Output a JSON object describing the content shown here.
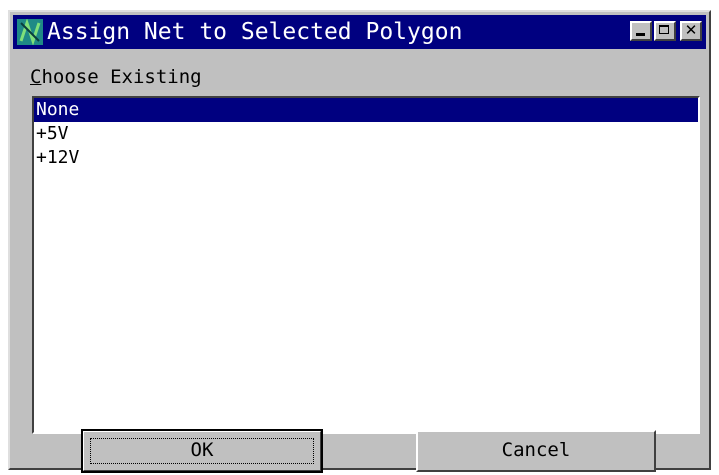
{
  "window": {
    "title": "Assign Net to Selected Polygon",
    "controls": [
      "minimize",
      "maximize",
      "close"
    ]
  },
  "section": {
    "label_first": "C",
    "label_rest": "hoose Existing"
  },
  "nets": {
    "items": [
      "None",
      "+5V",
      "+12V"
    ],
    "selected": "None"
  },
  "buttons": {
    "ok": "OK",
    "cancel": "Cancel"
  },
  "colors": {
    "title_bar": "#000080",
    "face": "#c0c0c0",
    "selection": "#000080",
    "icon": "#1f8a86"
  },
  "icons": {
    "app": "net-assign-icon",
    "close": "close-icon",
    "minimize": "minimize-icon",
    "maximize": "maximize-icon"
  }
}
